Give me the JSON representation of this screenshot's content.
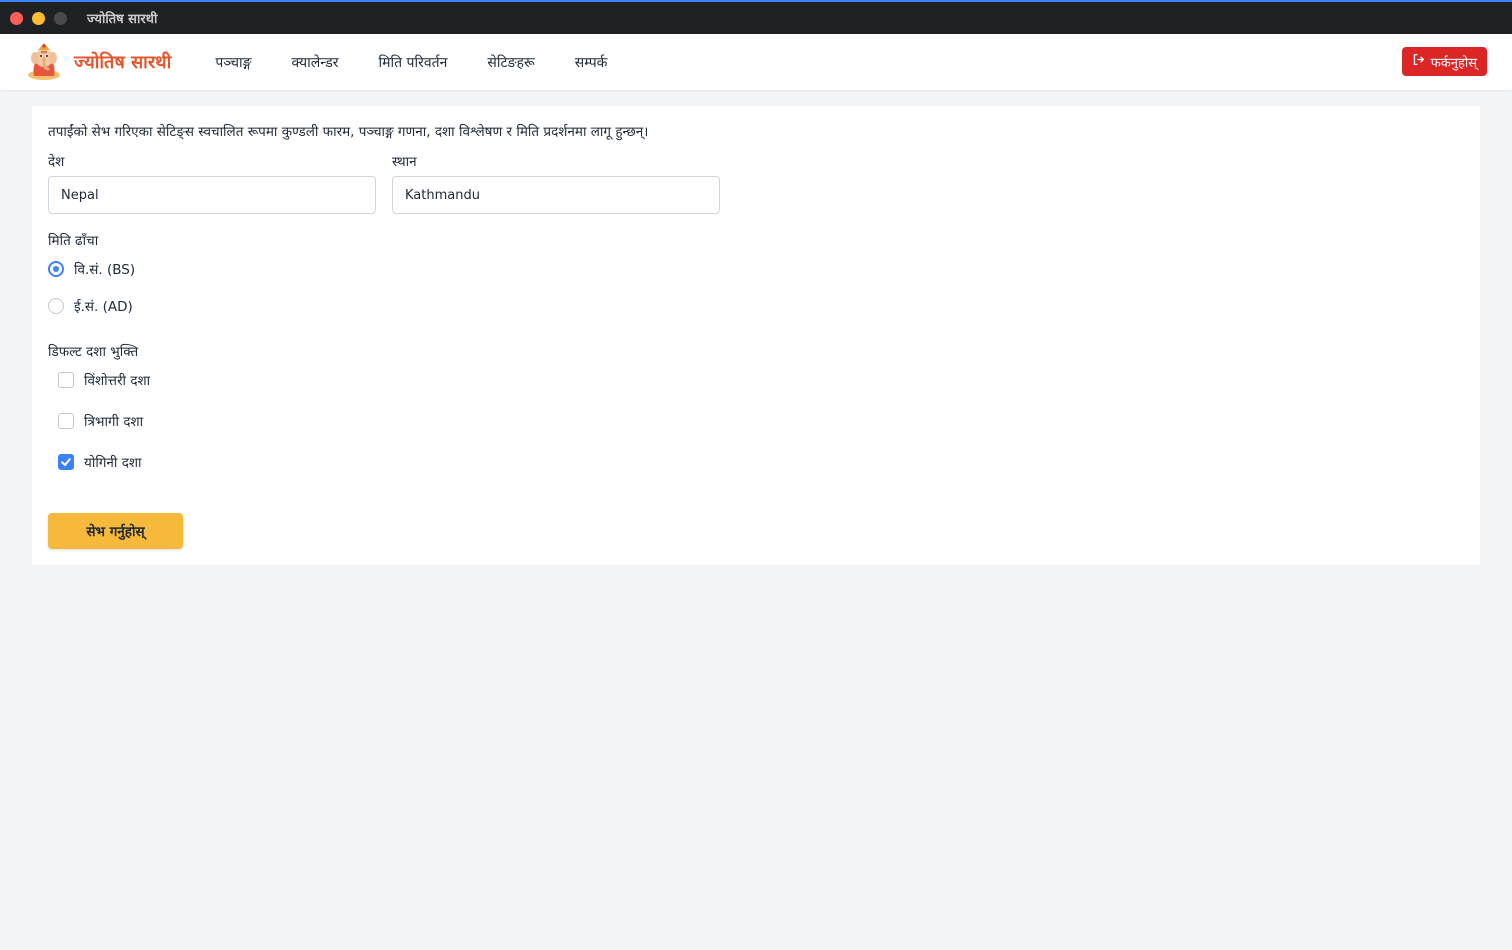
{
  "window": {
    "title": "ज्योतिष सारथी"
  },
  "navbar": {
    "brand": "ज्योतिष सारथी",
    "links": [
      {
        "label": "पञ्चाङ्ग"
      },
      {
        "label": "क्यालेन्डर"
      },
      {
        "label": "मिति परिवर्तन"
      },
      {
        "label": "सेटिङहरू"
      },
      {
        "label": "सम्पर्क"
      }
    ],
    "logout_label": "फर्कनुहोस्",
    "logout_icon": "logout-icon"
  },
  "settings": {
    "intro": "तपाईंको सेभ गरिएका सेटिङ्स स्वचालित रूपमा कुण्डली फारम, पञ्चाङ्ग गणना, दशा विश्लेषण र मिति प्रदर्शनमा लागू हुन्छन्।",
    "country": {
      "label": "देश",
      "value": "Nepal"
    },
    "location": {
      "label": "स्थान",
      "value": "Kathmandu"
    },
    "date_format": {
      "label": "मिति ढाँचा",
      "options": [
        {
          "label": "वि.सं. (BS)",
          "selected": true
        },
        {
          "label": "ई.सं. (AD)",
          "selected": false
        }
      ]
    },
    "dasha": {
      "label": "डिफल्ट दशा भुक्ति",
      "options": [
        {
          "label": "विंशोत्तरी दशा",
          "checked": false
        },
        {
          "label": "त्रिभागी दशा",
          "checked": false
        },
        {
          "label": "योगिनी दशा",
          "checked": true
        }
      ]
    },
    "save_label": "सेभ गर्नुहोस्"
  },
  "colors": {
    "brand": "#e4572e",
    "logout": "#dc2626",
    "save": "#f6b93b",
    "accent": "#3b82f6"
  }
}
